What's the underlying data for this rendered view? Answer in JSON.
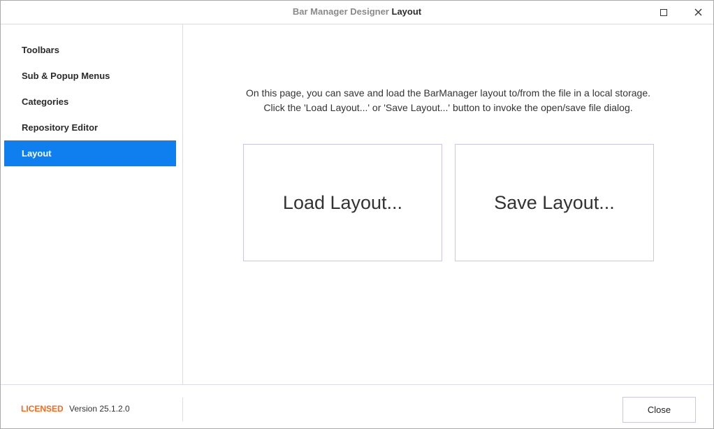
{
  "window": {
    "title_prefix": "Bar Manager Designer",
    "title_page": "Layout",
    "maximize_icon": "maximize-icon",
    "close_icon": "close-icon"
  },
  "sidebar": {
    "items": [
      {
        "label": "Toolbars",
        "selected": false
      },
      {
        "label": "Sub & Popup Menus",
        "selected": false
      },
      {
        "label": "Categories",
        "selected": false
      },
      {
        "label": "Repository Editor",
        "selected": false
      },
      {
        "label": "Layout",
        "selected": true
      }
    ]
  },
  "main": {
    "description_line1": "On this page, you can save and load the BarManager layout to/from the file in a local storage.",
    "description_line2": "Click the 'Load Layout...' or 'Save Layout...' button to invoke the open/save file dialog.",
    "load_label": "Load Layout...",
    "save_label": "Save Layout..."
  },
  "footer": {
    "license": "LICENSED",
    "version": "Version 25.1.2.0",
    "close_label": "Close"
  },
  "colors": {
    "accent": "#0f7ff0",
    "license": "#f26b1d",
    "border": "#c8c8e6"
  }
}
